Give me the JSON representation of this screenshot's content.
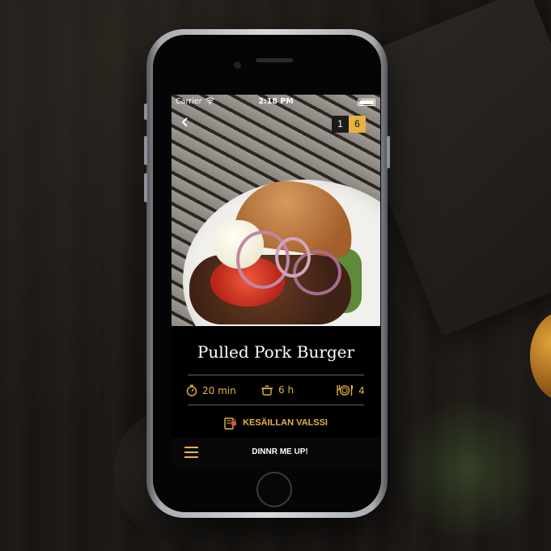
{
  "status_bar": {
    "carrier": "Carrier",
    "time": "2:18 PM",
    "wifi_icon": "wifi-icon",
    "battery_icon": "battery-icon"
  },
  "header": {
    "back_icon": "chevron-left-icon",
    "pager": {
      "current": "1",
      "total": "6"
    }
  },
  "recipe": {
    "title": "Pulled Pork Burger",
    "stats": [
      {
        "icon": "timer-icon",
        "value": "20 min"
      },
      {
        "icon": "pot-icon",
        "value": "6 h"
      },
      {
        "icon": "plate-cutlery-icon",
        "value": "4"
      }
    ],
    "collection": {
      "icon": "locked-book-icon",
      "label": "KESÄILLAN VALSSI"
    }
  },
  "bottom_bar": {
    "menu_icon": "hamburger-menu-icon",
    "brand": "DINNR ME UP!"
  },
  "colors": {
    "accent": "#e6b341",
    "background": "#000000",
    "text": "#ffffff"
  }
}
